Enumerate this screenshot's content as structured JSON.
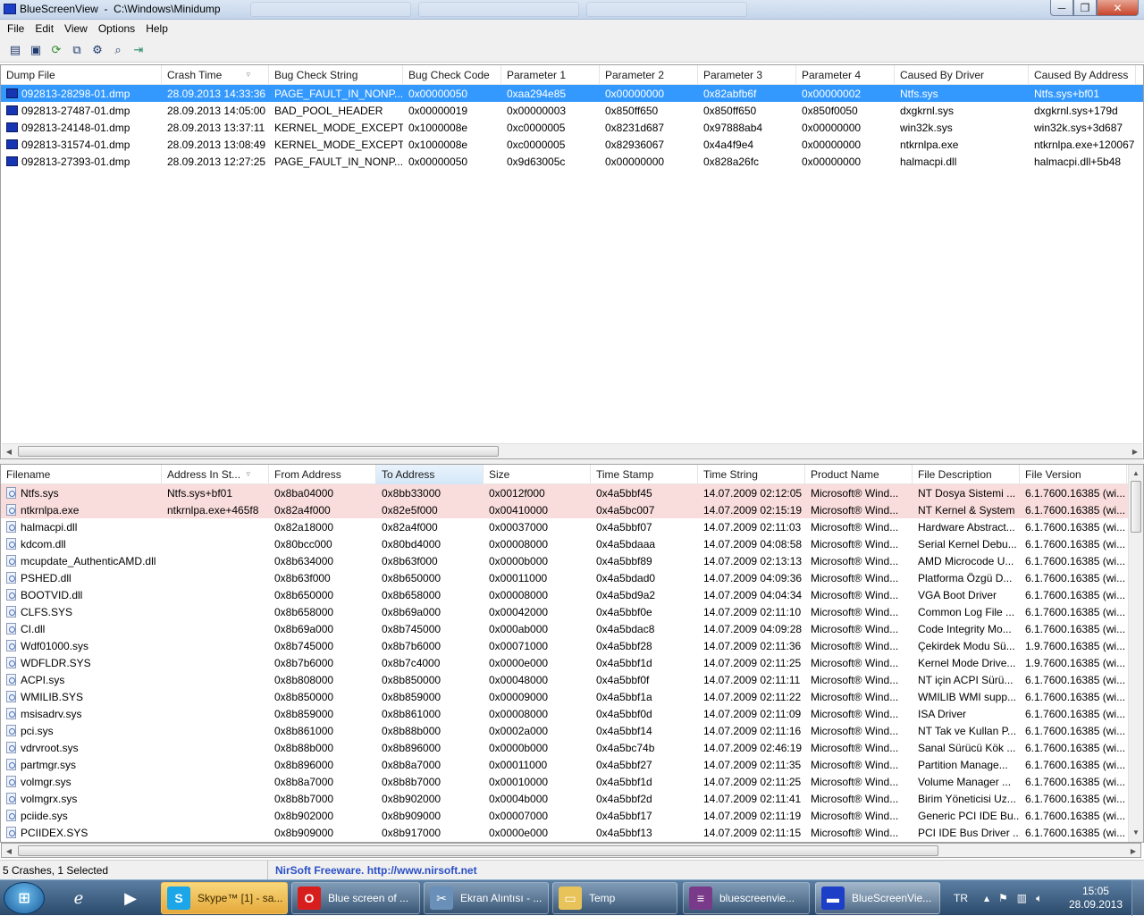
{
  "window": {
    "title": "BlueScreenView  -  C:\\Windows\\Minidump",
    "min": "─",
    "max": "❐",
    "close": "✕"
  },
  "menu": [
    "File",
    "Edit",
    "View",
    "Options",
    "Help"
  ],
  "toolbar": {
    "icons": [
      "properties-icon",
      "save-icon",
      "refresh-icon",
      "copy-icon",
      "options-icon",
      "find-icon",
      "exit-icon"
    ]
  },
  "crash_table": {
    "columns": [
      {
        "label": "Dump File",
        "w": 180
      },
      {
        "label": "Crash Time",
        "w": 120,
        "sort": true
      },
      {
        "label": "Bug Check String",
        "w": 150
      },
      {
        "label": "Bug Check Code",
        "w": 110
      },
      {
        "label": "Parameter 1",
        "w": 110
      },
      {
        "label": "Parameter 2",
        "w": 110
      },
      {
        "label": "Parameter 3",
        "w": 110
      },
      {
        "label": "Parameter 4",
        "w": 110
      },
      {
        "label": "Caused By Driver",
        "w": 150
      },
      {
        "label": "Caused By Address",
        "w": 120
      }
    ],
    "rows": [
      [
        "092813-28298-01.dmp",
        "28.09.2013 14:33:36",
        "PAGE_FAULT_IN_NONP...",
        "0x00000050",
        "0xaa294e85",
        "0x00000000",
        "0x82abfb6f",
        "0x00000002",
        "Ntfs.sys",
        "Ntfs.sys+bf01"
      ],
      [
        "092813-27487-01.dmp",
        "28.09.2013 14:05:00",
        "BAD_POOL_HEADER",
        "0x00000019",
        "0x00000003",
        "0x850ff650",
        "0x850ff650",
        "0x850f0050",
        "dxgkrnl.sys",
        "dxgkrnl.sys+179d"
      ],
      [
        "092813-24148-01.dmp",
        "28.09.2013 13:37:11",
        "KERNEL_MODE_EXCEPTI...",
        "0x1000008e",
        "0xc0000005",
        "0x8231d687",
        "0x97888ab4",
        "0x00000000",
        "win32k.sys",
        "win32k.sys+3d687"
      ],
      [
        "092813-31574-01.dmp",
        "28.09.2013 13:08:49",
        "KERNEL_MODE_EXCEPTI...",
        "0x1000008e",
        "0xc0000005",
        "0x82936067",
        "0x4a4f9e4",
        "0x00000000",
        "ntkrnlpa.exe",
        "ntkrnlpa.exe+120067"
      ],
      [
        "092813-27393-01.dmp",
        "28.09.2013 12:27:25",
        "PAGE_FAULT_IN_NONP...",
        "0x00000050",
        "0x9d63005c",
        "0x00000000",
        "0x828a26fc",
        "0x00000000",
        "halmacpi.dll",
        "halmacpi.dll+5b48"
      ]
    ],
    "selected_row": 0
  },
  "driver_table": {
    "columns": [
      {
        "label": "Filename",
        "w": 180
      },
      {
        "label": "Address In St...",
        "w": 120,
        "sort": true
      },
      {
        "label": "From Address",
        "w": 120
      },
      {
        "label": "To Address",
        "w": 120,
        "highlight": true
      },
      {
        "label": "Size",
        "w": 120
      },
      {
        "label": "Time Stamp",
        "w": 120
      },
      {
        "label": "Time String",
        "w": 120
      },
      {
        "label": "Product Name",
        "w": 120
      },
      {
        "label": "File Description",
        "w": 120
      },
      {
        "label": "File Version",
        "w": 120
      }
    ],
    "rows": [
      [
        "Ntfs.sys",
        "Ntfs.sys+bf01",
        "0x8ba04000",
        "0x8bb33000",
        "0x0012f000",
        "0x4a5bbf45",
        "14.07.2009 02:12:05",
        "Microsoft® Wind...",
        "NT Dosya Sistemi ...",
        "6.1.7600.16385 (wi..."
      ],
      [
        "ntkrnlpa.exe",
        "ntkrnlpa.exe+465f8",
        "0x82a4f000",
        "0x82e5f000",
        "0x00410000",
        "0x4a5bc007",
        "14.07.2009 02:15:19",
        "Microsoft® Wind...",
        "NT Kernel & System",
        "6.1.7600.16385 (wi..."
      ],
      [
        "halmacpi.dll",
        "",
        "0x82a18000",
        "0x82a4f000",
        "0x00037000",
        "0x4a5bbf07",
        "14.07.2009 02:11:03",
        "Microsoft® Wind...",
        "Hardware Abstract...",
        "6.1.7600.16385 (wi..."
      ],
      [
        "kdcom.dll",
        "",
        "0x80bcc000",
        "0x80bd4000",
        "0x00008000",
        "0x4a5bdaaa",
        "14.07.2009 04:08:58",
        "Microsoft® Wind...",
        "Serial Kernel Debu...",
        "6.1.7600.16385 (wi..."
      ],
      [
        "mcupdate_AuthenticAMD.dll",
        "",
        "0x8b634000",
        "0x8b63f000",
        "0x0000b000",
        "0x4a5bbf89",
        "14.07.2009 02:13:13",
        "Microsoft® Wind...",
        "AMD Microcode U...",
        "6.1.7600.16385 (wi..."
      ],
      [
        "PSHED.dll",
        "",
        "0x8b63f000",
        "0x8b650000",
        "0x00011000",
        "0x4a5bdad0",
        "14.07.2009 04:09:36",
        "Microsoft® Wind...",
        "Platforma Özgü D...",
        "6.1.7600.16385 (wi..."
      ],
      [
        "BOOTVID.dll",
        "",
        "0x8b650000",
        "0x8b658000",
        "0x00008000",
        "0x4a5bd9a2",
        "14.07.2009 04:04:34",
        "Microsoft® Wind...",
        "VGA Boot Driver",
        "6.1.7600.16385 (wi..."
      ],
      [
        "CLFS.SYS",
        "",
        "0x8b658000",
        "0x8b69a000",
        "0x00042000",
        "0x4a5bbf0e",
        "14.07.2009 02:11:10",
        "Microsoft® Wind...",
        "Common Log File ...",
        "6.1.7600.16385 (wi..."
      ],
      [
        "CI.dll",
        "",
        "0x8b69a000",
        "0x8b745000",
        "0x000ab000",
        "0x4a5bdac8",
        "14.07.2009 04:09:28",
        "Microsoft® Wind...",
        "Code Integrity Mo...",
        "6.1.7600.16385 (wi..."
      ],
      [
        "Wdf01000.sys",
        "",
        "0x8b745000",
        "0x8b7b6000",
        "0x00071000",
        "0x4a5bbf28",
        "14.07.2009 02:11:36",
        "Microsoft® Wind...",
        "Çekirdek Modu Sü...",
        "1.9.7600.16385 (wi..."
      ],
      [
        "WDFLDR.SYS",
        "",
        "0x8b7b6000",
        "0x8b7c4000",
        "0x0000e000",
        "0x4a5bbf1d",
        "14.07.2009 02:11:25",
        "Microsoft® Wind...",
        "Kernel Mode Drive...",
        "1.9.7600.16385 (wi..."
      ],
      [
        "ACPI.sys",
        "",
        "0x8b808000",
        "0x8b850000",
        "0x00048000",
        "0x4a5bbf0f",
        "14.07.2009 02:11:11",
        "Microsoft® Wind...",
        "NT için ACPI Sürü...",
        "6.1.7600.16385 (wi..."
      ],
      [
        "WMILIB.SYS",
        "",
        "0x8b850000",
        "0x8b859000",
        "0x00009000",
        "0x4a5bbf1a",
        "14.07.2009 02:11:22",
        "Microsoft® Wind...",
        "WMILIB WMI supp...",
        "6.1.7600.16385 (wi..."
      ],
      [
        "msisadrv.sys",
        "",
        "0x8b859000",
        "0x8b861000",
        "0x00008000",
        "0x4a5bbf0d",
        "14.07.2009 02:11:09",
        "Microsoft® Wind...",
        "ISA Driver",
        "6.1.7600.16385 (wi..."
      ],
      [
        "pci.sys",
        "",
        "0x8b861000",
        "0x8b88b000",
        "0x0002a000",
        "0x4a5bbf14",
        "14.07.2009 02:11:16",
        "Microsoft® Wind...",
        "NT Tak ve Kullan P...",
        "6.1.7600.16385 (wi..."
      ],
      [
        "vdrvroot.sys",
        "",
        "0x8b88b000",
        "0x8b896000",
        "0x0000b000",
        "0x4a5bc74b",
        "14.07.2009 02:46:19",
        "Microsoft® Wind...",
        "Sanal Sürücü Kök ...",
        "6.1.7600.16385 (wi..."
      ],
      [
        "partmgr.sys",
        "",
        "0x8b896000",
        "0x8b8a7000",
        "0x00011000",
        "0x4a5bbf27",
        "14.07.2009 02:11:35",
        "Microsoft® Wind...",
        "Partition Manage...",
        "6.1.7600.16385 (wi..."
      ],
      [
        "volmgr.sys",
        "",
        "0x8b8a7000",
        "0x8b8b7000",
        "0x00010000",
        "0x4a5bbf1d",
        "14.07.2009 02:11:25",
        "Microsoft® Wind...",
        "Volume Manager ...",
        "6.1.7600.16385 (wi..."
      ],
      [
        "volmgrx.sys",
        "",
        "0x8b8b7000",
        "0x8b902000",
        "0x0004b000",
        "0x4a5bbf2d",
        "14.07.2009 02:11:41",
        "Microsoft® Wind...",
        "Birim Yöneticisi Uz...",
        "6.1.7600.16385 (wi..."
      ],
      [
        "pciide.sys",
        "",
        "0x8b902000",
        "0x8b909000",
        "0x00007000",
        "0x4a5bbf17",
        "14.07.2009 02:11:19",
        "Microsoft® Wind...",
        "Generic PCI IDE Bu...",
        "6.1.7600.16385 (wi..."
      ],
      [
        "PCIIDEX.SYS",
        "",
        "0x8b909000",
        "0x8b917000",
        "0x0000e000",
        "0x4a5bbf13",
        "14.07.2009 02:11:15",
        "Microsoft® Wind...",
        "PCI IDE Bus Driver ...",
        "6.1.7600.16385 (wi..."
      ]
    ],
    "pink_rows": [
      0,
      1
    ]
  },
  "status": {
    "left": "5 Crashes, 1 Selected",
    "link": "NirSoft Freeware.  http://www.nirsoft.net"
  },
  "taskbar": {
    "tasks": [
      {
        "label": "Skype™ [1] - sa...",
        "icon": "skype-icon",
        "kind": "skype"
      },
      {
        "label": "Blue screen of ...",
        "icon": "opera-icon",
        "kind": "normal"
      },
      {
        "label": "Ekran Alıntısı - ...",
        "icon": "snipping-icon",
        "kind": "normal"
      },
      {
        "label": "Temp",
        "icon": "folder-icon",
        "kind": "normal"
      },
      {
        "label": "bluescreenvie...",
        "icon": "winrar-icon",
        "kind": "normal"
      },
      {
        "label": "BlueScreenVie...",
        "icon": "bluescreenview-icon",
        "kind": "active"
      }
    ],
    "language": "TR",
    "time": "15:05",
    "date": "28.09.2013"
  },
  "colors": {
    "selection": "#3399ff",
    "highlight_row": "#f9dddd",
    "link": "#2b4fc7"
  }
}
